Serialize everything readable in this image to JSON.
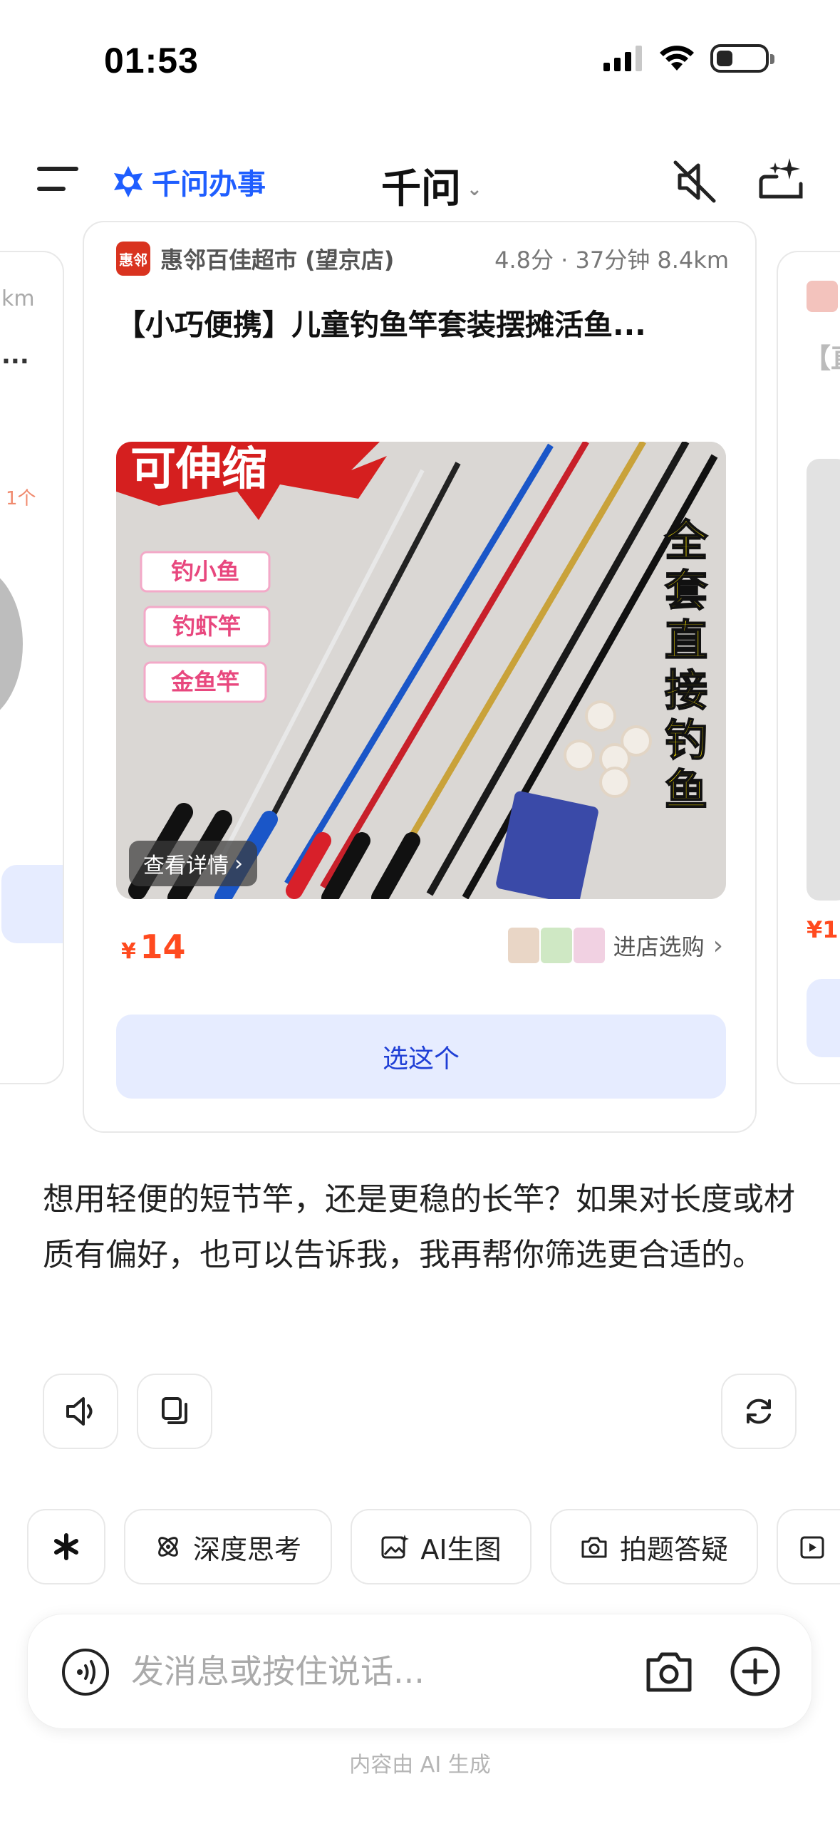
{
  "status_bar": {
    "time": "01:53"
  },
  "header": {
    "brand": "千问办事",
    "title": "千问",
    "icons": [
      "menu-icon",
      "brand-logo-icon",
      "mute-icon",
      "new-chat-icon"
    ]
  },
  "main_card": {
    "shop_logo_text": "惠邻",
    "shop_name": "惠邻百佳超市 (望京店)",
    "shop_meta": "4.8分 · 37分钟 8.4km",
    "product_title": "【小巧便携】儿童钓鱼竿套装摆摊活鱼...",
    "image_text": {
      "banner": "可伸缩",
      "tags": [
        "钓小鱼",
        "钓虾竿",
        "金鱼竿"
      ],
      "vertical": "全套直接钓鱼"
    },
    "detail_label": "查看详情",
    "price_currency": "¥",
    "price_value": "14",
    "store_link": "进店选购",
    "select_label": "选这个"
  },
  "side_card_left": {
    "meta": "km",
    "title": "...",
    "badge": "1个",
    "link": ""
  },
  "side_card_right": {
    "title": "【直",
    "price": "¥1"
  },
  "message": {
    "text": "想用轻便的短节竿，还是更稳的长竿？如果对长度或材质有偏好，也可以告诉我，我再帮你筛选更合适的。"
  },
  "actions": [
    "speaker-icon",
    "copy-icon",
    "refresh-icon"
  ],
  "chips": [
    {
      "label": "",
      "icon": "sparkle-icon"
    },
    {
      "label": "深度思考",
      "icon": "deep-think-icon"
    },
    {
      "label": "AI生图",
      "icon": "image-gen-icon"
    },
    {
      "label": "拍题答疑",
      "icon": "photo-question-icon"
    },
    {
      "label": "",
      "icon": "more-tool-icon"
    }
  ],
  "input": {
    "placeholder": "发消息或按住说话..."
  },
  "footer_note": "内容由 AI 生成",
  "colors": {
    "brand_blue": "#1f5eff",
    "price_red": "#ff4a1f",
    "select_bg": "#e6ecff"
  }
}
